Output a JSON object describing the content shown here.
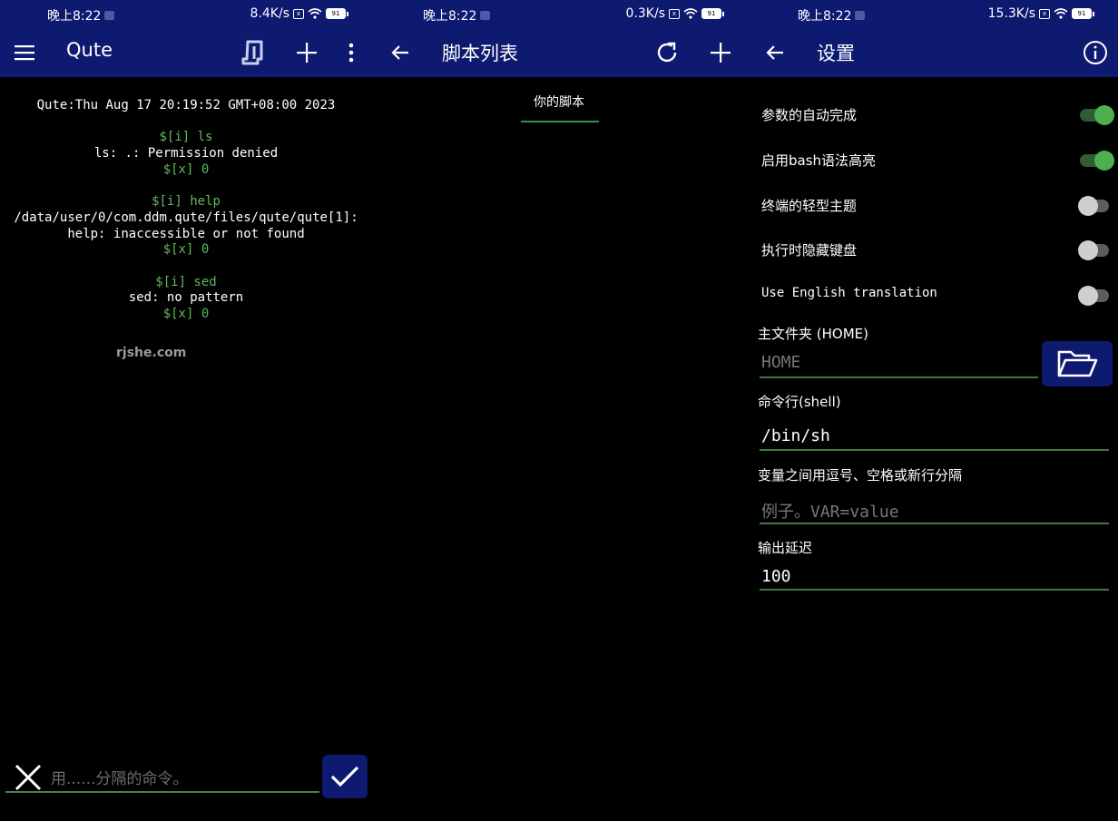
{
  "panels": {
    "terminal": {
      "status": {
        "time": "晚上8:22",
        "speed": "8.4K/s",
        "battery": "91"
      },
      "title": "Qute",
      "lines": [
        {
          "text": "Qute:Thu Aug 17 20:19:52 GMT+08:00 2023",
          "color": "white"
        },
        {
          "text": "",
          "color": "gap"
        },
        {
          "text": "$[i] ls",
          "color": "green"
        },
        {
          "text": "ls: .: Permission denied",
          "color": "white"
        },
        {
          "text": "$[x] 0",
          "color": "green"
        },
        {
          "text": "",
          "color": "gap"
        },
        {
          "text": "$[i] help",
          "color": "green"
        },
        {
          "text": "/data/user/0/com.ddm.qute/files/qute/qute[1]:",
          "color": "white"
        },
        {
          "text": "help: inaccessible or not found",
          "color": "white"
        },
        {
          "text": "$[x] 0",
          "color": "green"
        },
        {
          "text": "",
          "color": "gap"
        },
        {
          "text": "$[i] sed",
          "color": "green"
        },
        {
          "text": "sed: no pattern",
          "color": "white"
        },
        {
          "text": "$[x] 0",
          "color": "green"
        }
      ],
      "watermark": "rjshe.com",
      "command_placeholder": "用......分隔的命令。"
    },
    "scripts": {
      "status": {
        "time": "晚上8:22",
        "speed": "0.3K/s",
        "battery": "91"
      },
      "title": "脚本列表",
      "tab": "你的脚本"
    },
    "settings": {
      "status": {
        "time": "晚上8:22",
        "speed": "15.3K/s",
        "battery": "91"
      },
      "title": "设置",
      "toggles": [
        {
          "label": "参数的自动完成",
          "on": true
        },
        {
          "label": "启用bash语法高亮",
          "on": true
        },
        {
          "label": "终端的轻型主题",
          "on": false
        },
        {
          "label": "执行时隐藏键盘",
          "on": false
        },
        {
          "label": "Use English translation",
          "on": false
        }
      ],
      "home_label": "主文件夹 (HOME)",
      "home_placeholder": "HOME",
      "shell_label": "命令行(shell)",
      "shell_value": "/bin/sh",
      "vars_label": "变量之间用逗号、空格或新行分隔",
      "vars_placeholder": "例子。VAR=value",
      "delay_label": "输出延迟",
      "delay_value": "100"
    }
  },
  "colors": {
    "toolbar": "#0e1970",
    "accent_green": "#4caf50",
    "term_green": "#5fb85f"
  },
  "icons": [
    "menu-icon",
    "script-icon",
    "plus-icon",
    "more-vert-icon",
    "back-arrow-icon",
    "refresh-icon",
    "info-icon",
    "close-icon",
    "check-icon",
    "folder-open-icon"
  ]
}
